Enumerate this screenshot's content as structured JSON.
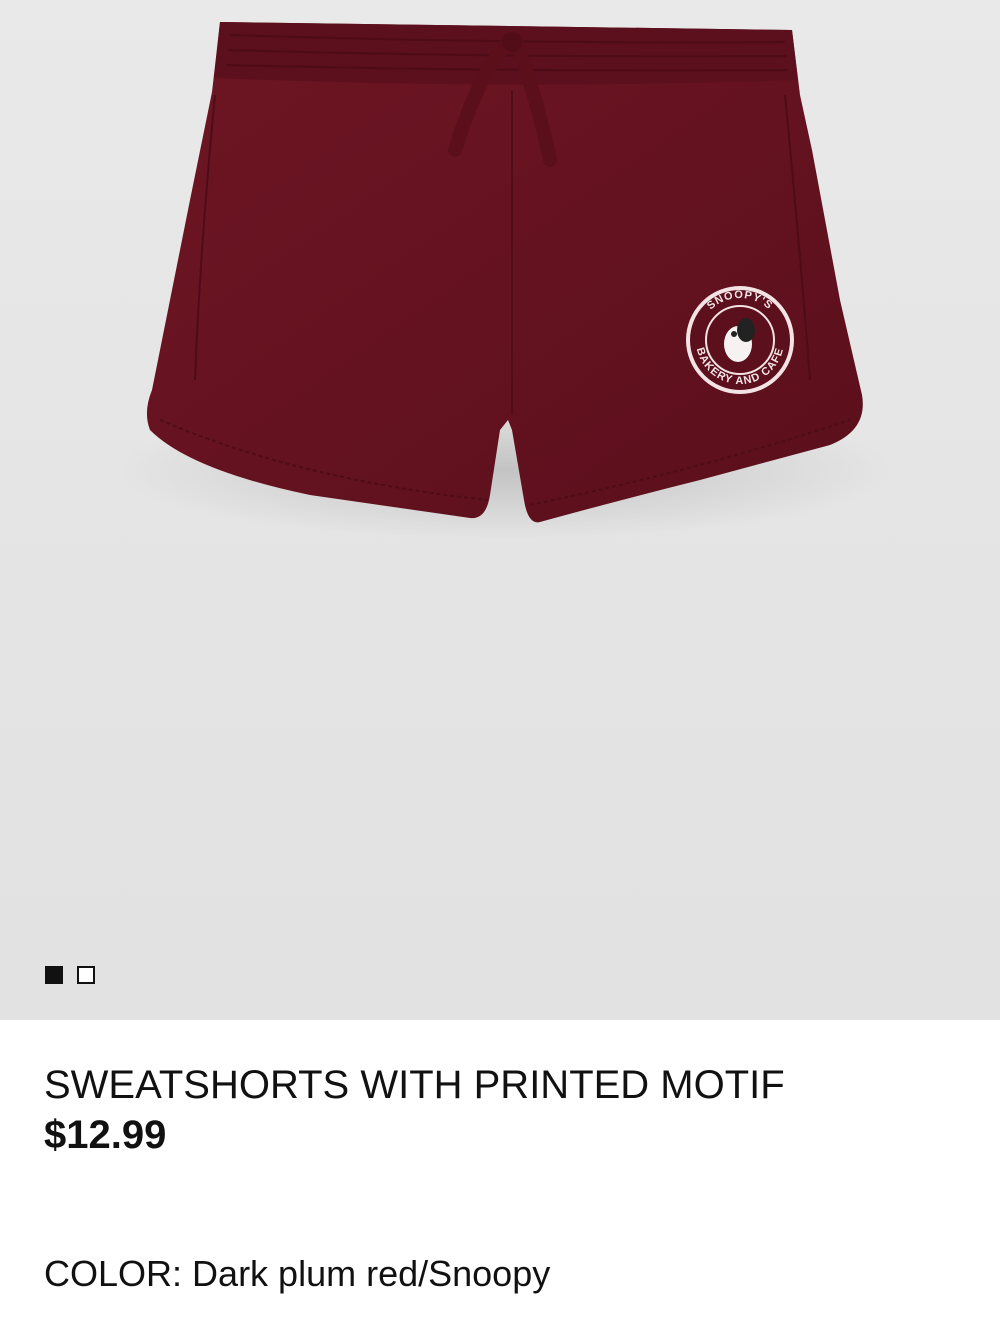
{
  "product": {
    "title": "SWEATSHORTS WITH PRINTED MOTIF",
    "price": "$12.99",
    "color_label": "COLOR:",
    "color_value": "Dark plum red/Snoopy"
  },
  "gallery": {
    "slides": [
      {
        "name": "image-1",
        "active": true
      },
      {
        "name": "image-2",
        "active": false
      }
    ]
  },
  "logo": {
    "text_top": "SNOOPY'S",
    "text_bottom": "BAKERY AND CAFE"
  },
  "colors": {
    "garment": "#6a1420",
    "background": "#e6e6e6",
    "text": "#111111"
  }
}
